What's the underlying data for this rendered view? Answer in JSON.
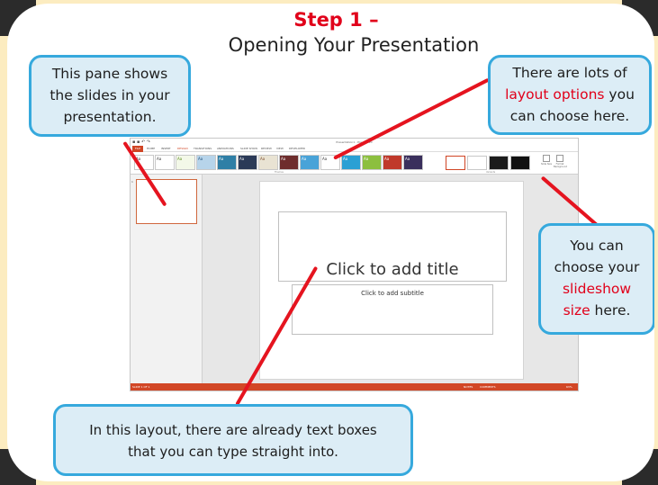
{
  "step_title": "Step 1 –",
  "subtitle": "Opening Your Presentation",
  "callouts": {
    "pane": {
      "lines": [
        "This pane shows",
        "the slides in your",
        "presentation."
      ]
    },
    "layout": {
      "line1": "There are lots of",
      "highlight": "layout options",
      "after_highlight": " you",
      "line3": "can choose here."
    },
    "size": {
      "line1": "You can",
      "line2": "choose your",
      "highlight1": "slideshow",
      "highlight2": "size",
      "after_highlight": " here."
    },
    "textboxes": {
      "lines": [
        "In this layout, there are already text boxes",
        "that you can type straight into."
      ]
    }
  },
  "colors": {
    "accent_red": "#e1001a",
    "callout_border": "#36a9dd",
    "callout_fill": "#dcedf6",
    "ppt_orange": "#d24726"
  },
  "ppt": {
    "window_title": "Presentation1 - PowerPoint",
    "tabs": [
      "FILE",
      "HOME",
      "INSERT",
      "DESIGN",
      "TRANSITIONS",
      "ANIMATIONS",
      "SLIDE SHOW",
      "REVIEW",
      "VIEW",
      "DEVELOPER"
    ],
    "theme_glyph": "Aa",
    "group_themes": "Themes",
    "group_variants": "Variants",
    "button_slide_size": "Slide Size",
    "button_format_background": "Format Background",
    "slide_number": "1",
    "title_placeholder": "Click to add title",
    "subtitle_placeholder": "Click to add subtitle",
    "status_slide": "SLIDE 1 OF 1",
    "status_notes": "NOTES",
    "status_comments": "COMMENTS",
    "status_zoom": "63%"
  }
}
